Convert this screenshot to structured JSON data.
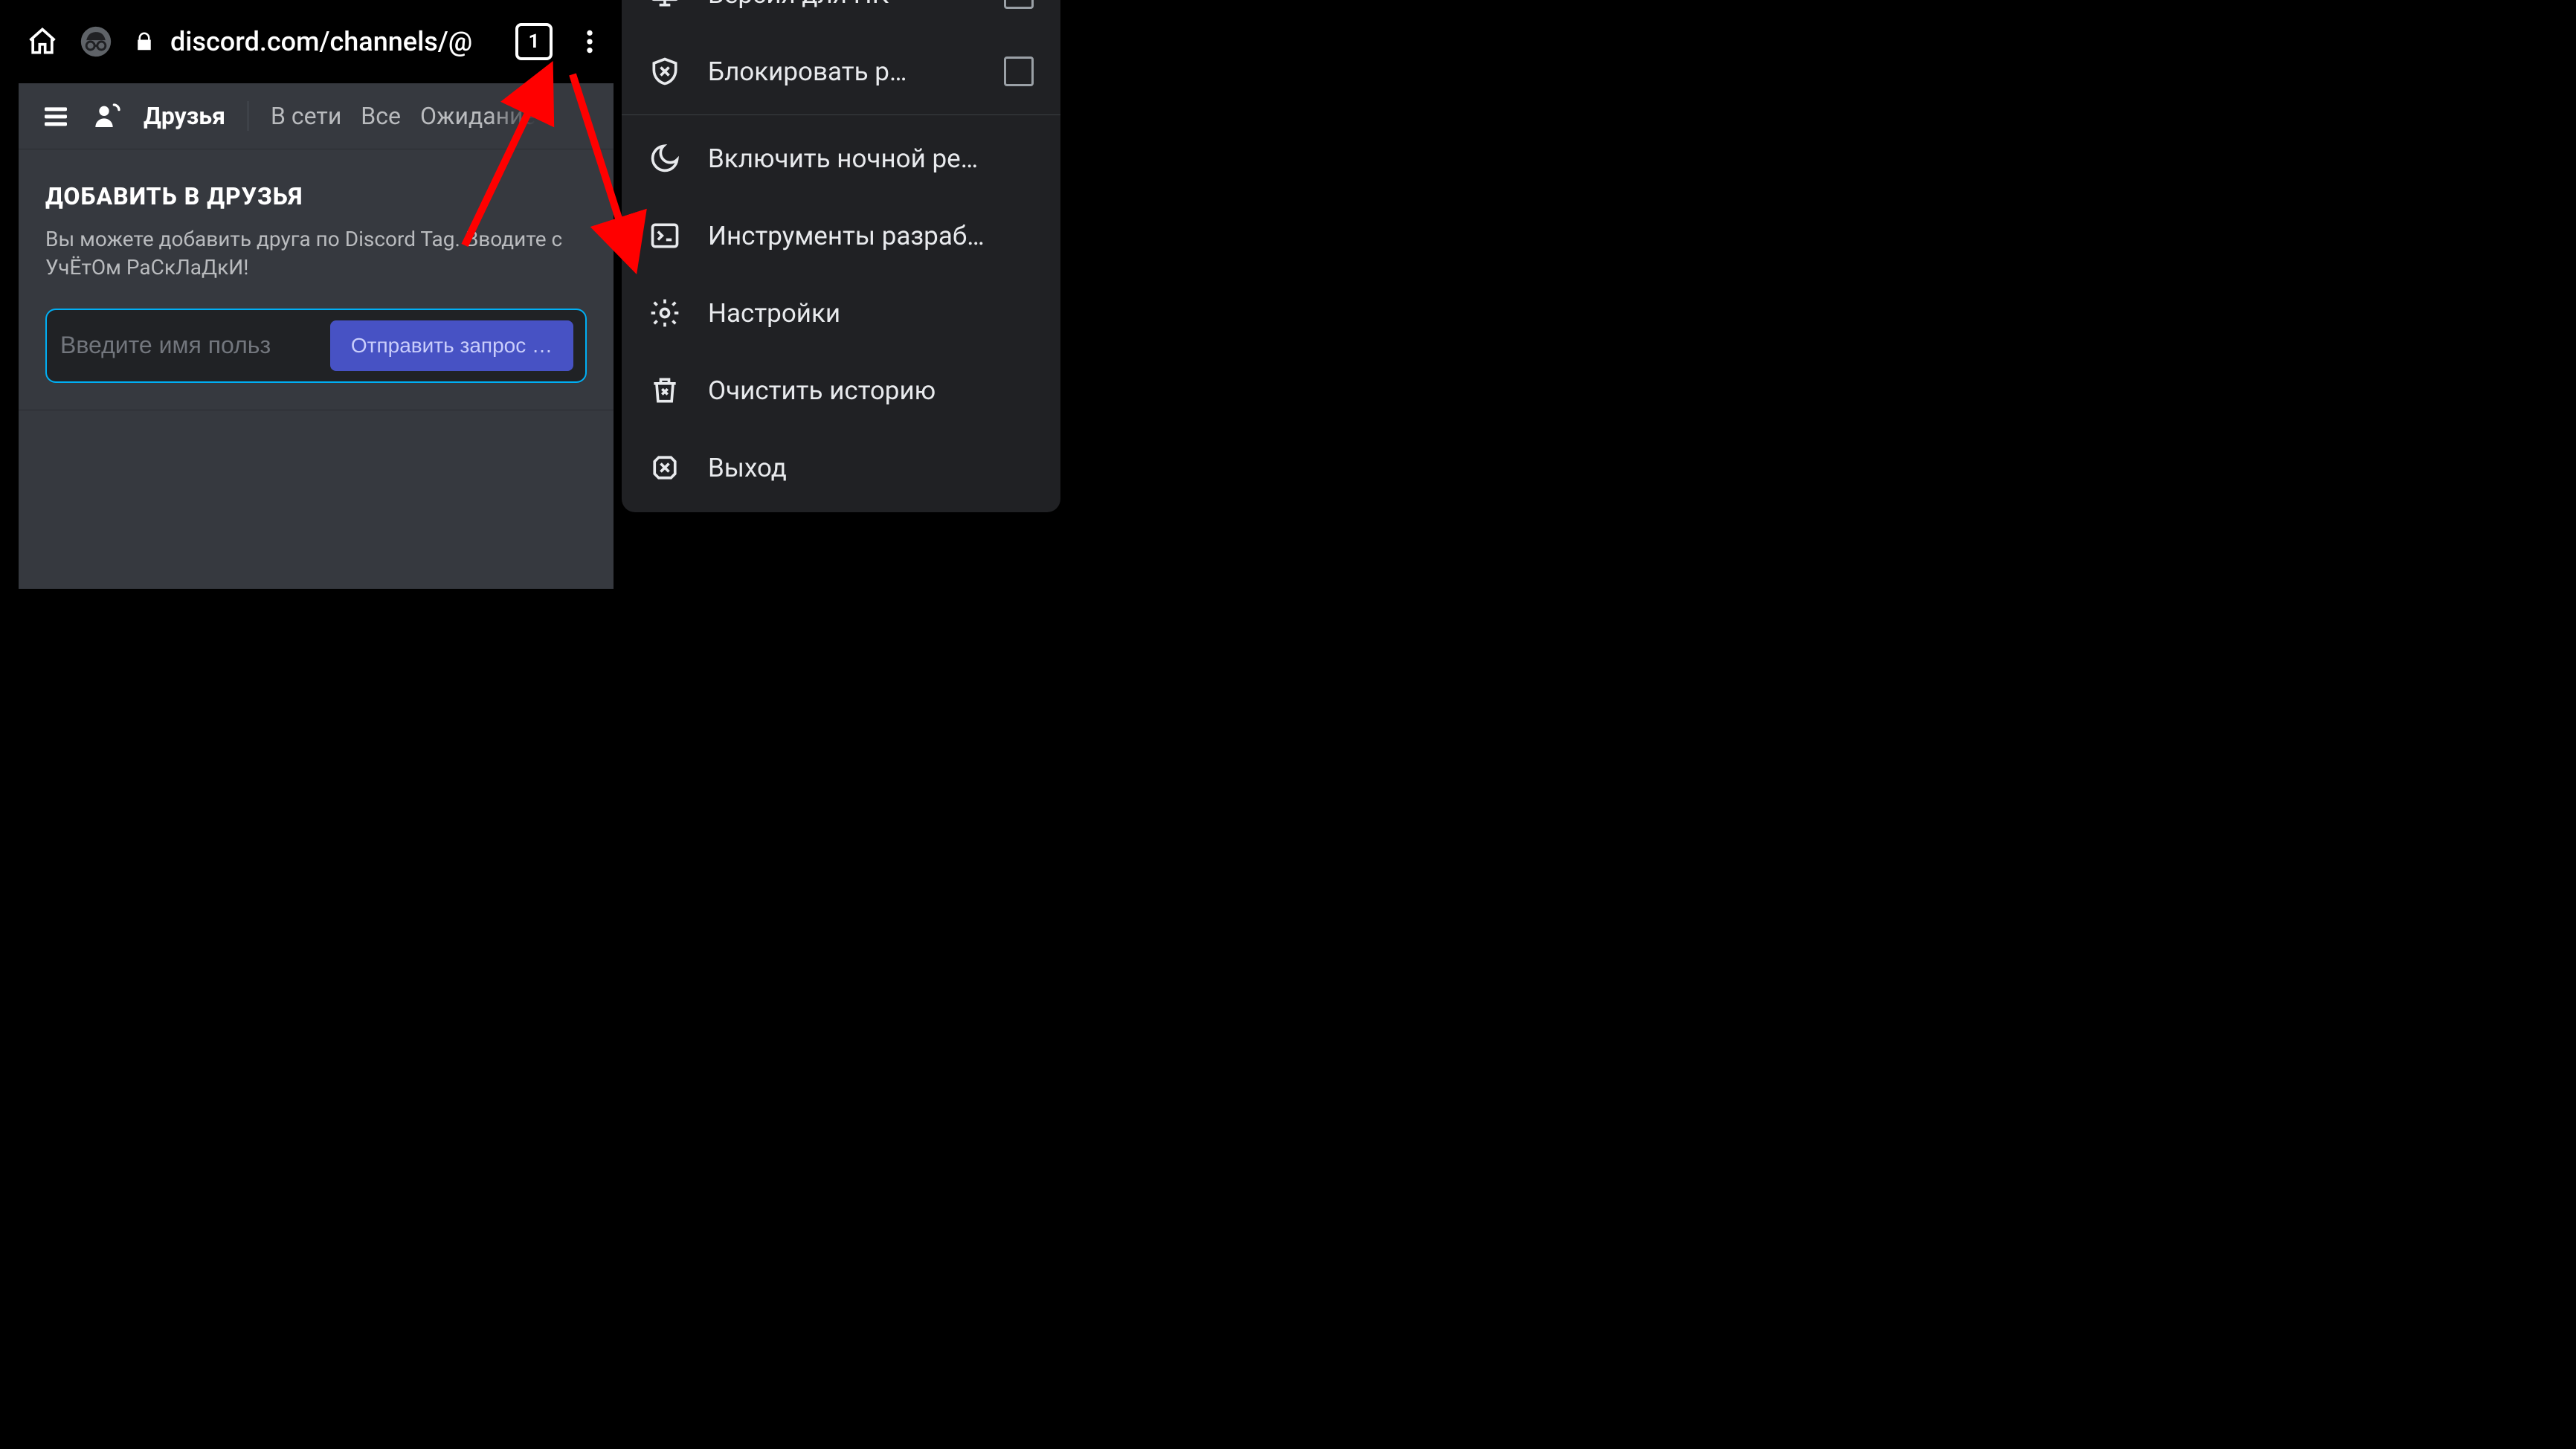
{
  "colors": {
    "accent": "#5865f2",
    "focus": "#00aff4",
    "arrow": "#ff0000"
  },
  "browser": {
    "url": "discord.com/channels/@",
    "tab_count": "1"
  },
  "discord": {
    "header": {
      "title": "Друзья",
      "tabs": [
        "В сети",
        "Все",
        "Ожидание"
      ]
    },
    "add_friend": {
      "title": "ДОБАВИТЬ В ДРУЗЬЯ",
      "description": "Вы можете добавить друга по Discord Tag. Вводите с УчЁтОм РаСкЛаДкИ!",
      "placeholder": "Введите имя польз",
      "button": "Отправить запрос …"
    }
  },
  "chrome_menu": {
    "items": [
      {
        "icon": "monitor",
        "label": "Версия для ПК",
        "checkbox": true
      },
      {
        "icon": "shield-x",
        "label": "Блокировать р…",
        "checkbox": true
      },
      {
        "separator": true
      },
      {
        "icon": "moon",
        "label": "Включить ночной ре…"
      },
      {
        "icon": "terminal",
        "label": "Инструменты разраб…"
      },
      {
        "icon": "gear",
        "label": "Настройки"
      },
      {
        "icon": "trash",
        "label": "Очистить историю"
      },
      {
        "icon": "exit",
        "label": "Выход"
      }
    ]
  }
}
